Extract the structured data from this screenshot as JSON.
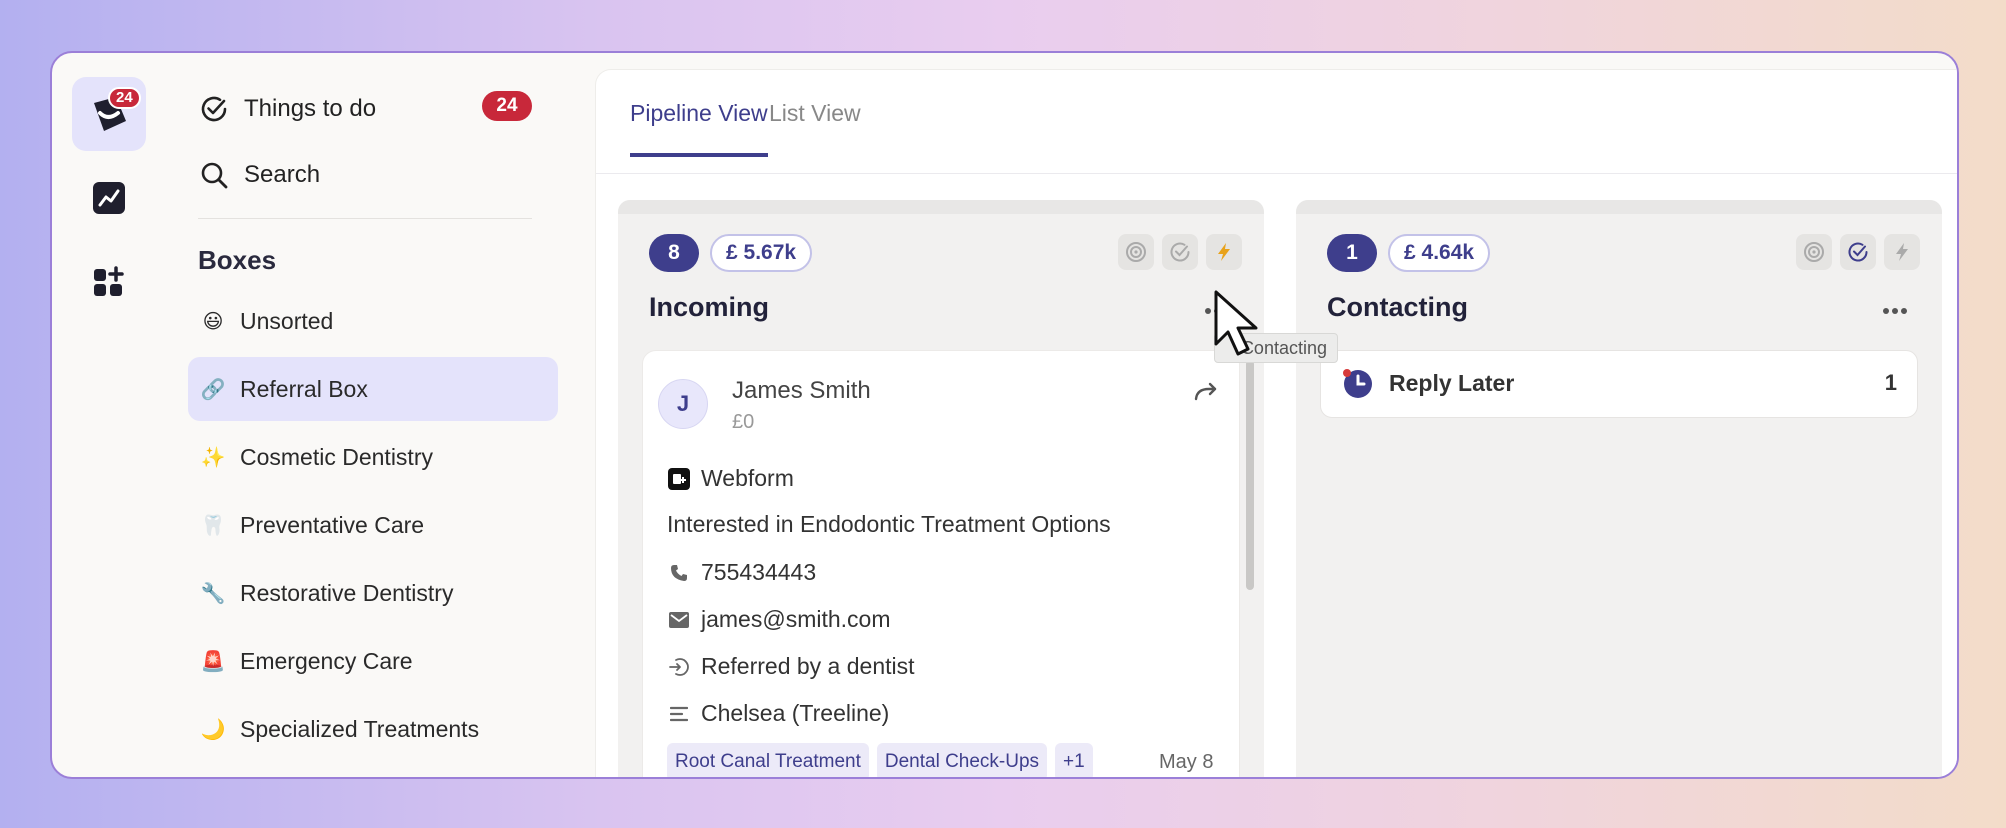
{
  "rail": {
    "badge": "24"
  },
  "sidebar": {
    "things_to_do": "Things to do",
    "things_badge": "24",
    "search": "Search",
    "boxes_title": "Boxes",
    "boxes": [
      {
        "emoji": "😃",
        "label": "Unsorted"
      },
      {
        "emoji": "🔗",
        "label": "Referral Box"
      },
      {
        "emoji": "✨",
        "label": "Cosmetic Dentistry"
      },
      {
        "emoji": "🦷",
        "label": "Preventative Care"
      },
      {
        "emoji": "🔧",
        "label": "Restorative Dentistry"
      },
      {
        "emoji": "🚨",
        "label": "Emergency Care"
      },
      {
        "emoji": "🌙",
        "label": "Specialized Treatments"
      }
    ]
  },
  "tabs": [
    {
      "label": "Pipeline View"
    },
    {
      "label": "List View"
    }
  ],
  "columns": [
    {
      "count": "8",
      "value": "£ 5.67k",
      "title": "Incoming",
      "card": {
        "initial": "J",
        "name": "James Smith",
        "amount": "£0",
        "source": "Webform",
        "note": "Interested in Endodontic Treatment Options",
        "phone": "755434443",
        "email": "james@smith.com",
        "referral": "Referred by a dentist",
        "location": "Chelsea (Treeline)",
        "tags": [
          "Root Canal Treatment",
          "Dental Check-Ups",
          "+1"
        ],
        "date": "May 8"
      }
    },
    {
      "count": "1",
      "value": "£ 4.64k",
      "title": "Contacting",
      "reply": {
        "label": "Reply Later",
        "count": "1"
      }
    }
  ],
  "tooltip": "Contacting",
  "colors": {
    "accent": "#3e3e8c",
    "badge_red": "#c8283a",
    "active_box_bg": "#e4e3fb",
    "bolt_yellow": "#e8a21a"
  }
}
